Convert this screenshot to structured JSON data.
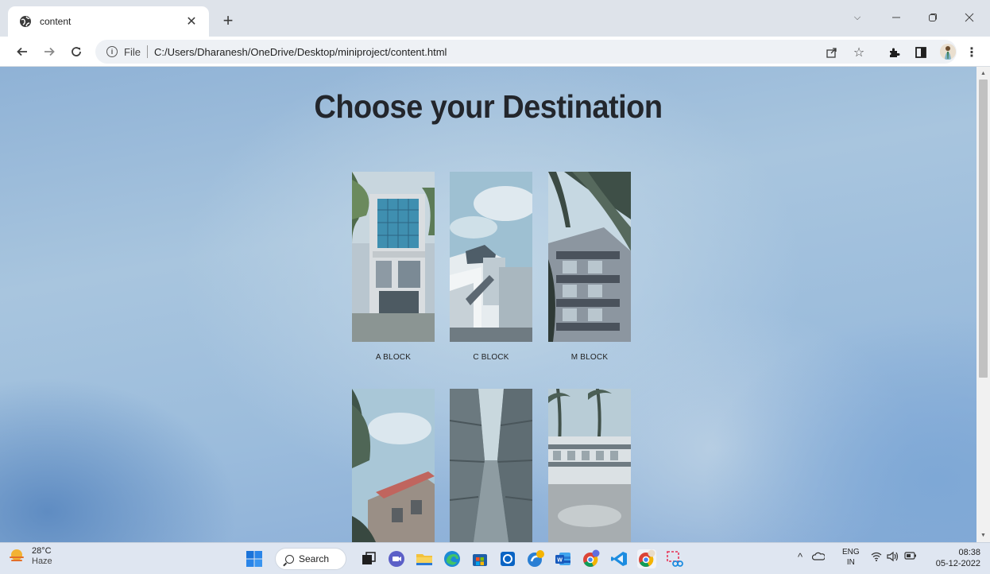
{
  "browser": {
    "tab": {
      "title": "content"
    },
    "address": {
      "scheme_label": "File",
      "url": "C:/Users/Dharanesh/OneDrive/Desktop/miniproject/content.html"
    }
  },
  "page": {
    "title": "Choose your Destination",
    "destinations": [
      {
        "label": "A BLOCK"
      },
      {
        "label": "C BLOCK"
      },
      {
        "label": "M BLOCK"
      },
      {
        "label": ""
      },
      {
        "label": ""
      },
      {
        "label": ""
      }
    ]
  },
  "taskbar": {
    "weather": {
      "temperature": "28°C",
      "condition": "Haze"
    },
    "search_label": "Search",
    "language": {
      "line1": "ENG",
      "line2": "IN"
    },
    "clock": {
      "time": "08:38",
      "date": "05-12-2022"
    }
  },
  "icons": {
    "tab": [
      "globe-icon",
      "close-icon",
      "new-tab-icon"
    ],
    "window": [
      "minimize-icon",
      "restore-icon",
      "window-close-icon",
      "tab-search-icon"
    ],
    "toolbar": [
      "back-icon",
      "forward-icon",
      "reload-icon",
      "info-icon",
      "share-icon",
      "star-icon",
      "extensions-icon",
      "side-panel-icon",
      "menu-icon"
    ],
    "taskbar": [
      "windows-start-icon",
      "search-icon",
      "task-view-icon",
      "chat-icon",
      "file-explorer-icon",
      "edge-icon",
      "store-icon",
      "outlook-icon",
      "copilot-icon",
      "word-icon",
      "chrome-icon",
      "vscode-icon",
      "chrome-profile-icon",
      "snipping-tool-icon",
      "tray-chevron-icon",
      "onedrive-icon",
      "wifi-icon",
      "volume-icon",
      "battery-icon"
    ]
  },
  "colors": {
    "page_title": "#23262c",
    "tab_strip": "#dee3ea",
    "taskbar": "#dfe6f1"
  }
}
